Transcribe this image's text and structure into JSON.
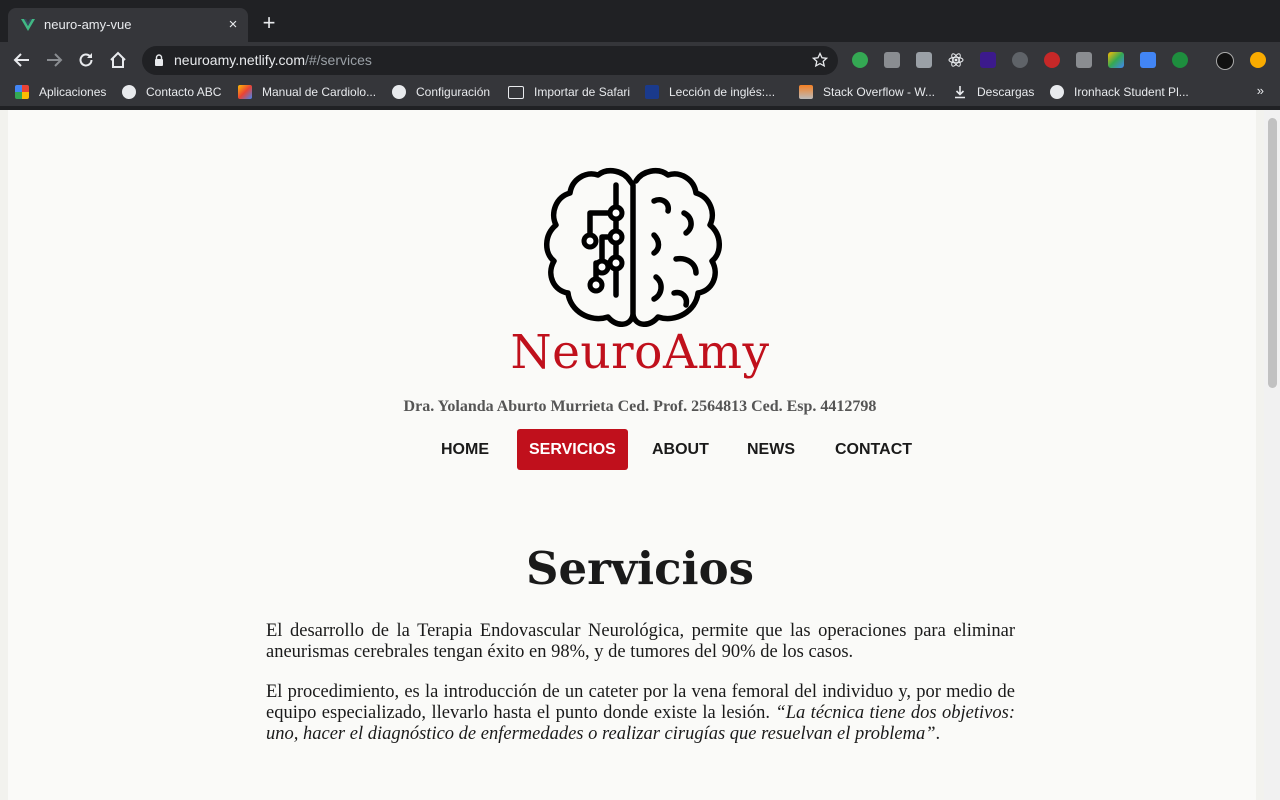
{
  "browser": {
    "tab": {
      "title": "neuro-amy-vue",
      "close": "×"
    },
    "new_tab": "+",
    "url": {
      "host": "neuroamy.netlify.com",
      "path": "/#/services"
    },
    "bookmarks": [
      {
        "label": "Aplicaciones",
        "icon": "apps-grid-icon"
      },
      {
        "label": "Contacto ABC",
        "icon": "globe-icon"
      },
      {
        "label": "Manual de Cardiolo...",
        "icon": "manual-icon"
      },
      {
        "label": "Configuración",
        "icon": "gear-icon"
      },
      {
        "label": "Importar de Safari",
        "icon": "folder-icon"
      },
      {
        "label": "Lección de inglés:...",
        "icon": "lesson-icon"
      },
      {
        "label": "Stack Overflow - W...",
        "icon": "stack-overflow-icon"
      },
      {
        "label": "Descargas",
        "icon": "download-icon"
      },
      {
        "label": "Ironhack Student Pl...",
        "icon": "globe-icon"
      }
    ],
    "bookmarks_more": "»",
    "colors": {
      "chrome_dark": "#202124",
      "chrome_mid": "#35363a"
    }
  },
  "site": {
    "brand": "NeuroAmy",
    "subtitle": "Dra. Yolanda Aburto Murrieta Ced. Prof. 2564813 Ced. Esp. 4412798",
    "nav": [
      {
        "label": "HOME",
        "active": false
      },
      {
        "label": "SERVICIOS",
        "active": true
      },
      {
        "label": "ABOUT",
        "active": false
      },
      {
        "label": "NEWS",
        "active": false
      },
      {
        "label": "CONTACT",
        "active": false
      }
    ],
    "colors": {
      "accent": "#c0101c",
      "text": "#1a1a1a"
    }
  },
  "services": {
    "heading": "Servicios",
    "p1": "El desarrollo de la Terapia Endovascular Neurológica, permite que las operaciones para eliminar aneurismas cerebrales tengan éxito en 98%, y de tumores del 90% de los casos.",
    "p2_plain": "El procedimiento, es la introducción de un cateter por la vena femoral del individuo y, por medio de equipo especializado, llevarlo hasta el punto donde existe la lesión. ",
    "p2_italic": "“La técnica tiene dos objetivos: uno, hacer el diagnóstico de enfermedades o realizar cirugías que resuelvan el problema”",
    "p2_end": "."
  }
}
